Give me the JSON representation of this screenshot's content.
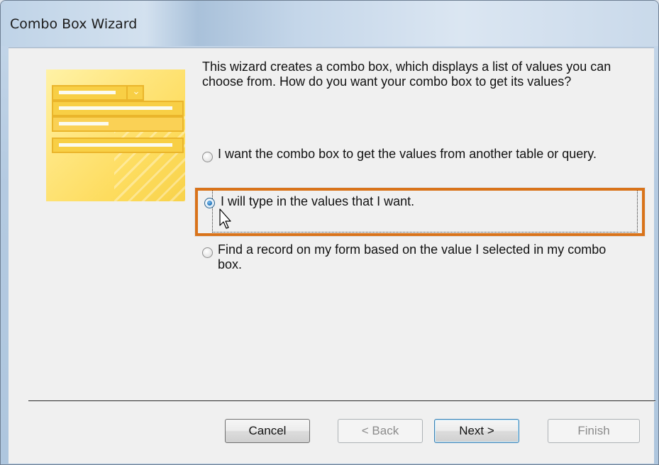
{
  "window": {
    "title": "Combo Box Wizard"
  },
  "intro": {
    "text": "This wizard creates a combo box, which displays a list of values you can choose from.  How do you want your combo box to get its values?"
  },
  "options": [
    {
      "label": "I want the combo box to get the values from another table or query.",
      "checked": false
    },
    {
      "label": "I will type in the values that I want.",
      "checked": true
    },
    {
      "label": "Find a record on my form based on the value I selected in my combo box.",
      "checked": false
    }
  ],
  "buttons": {
    "cancel": "Cancel",
    "back": "< Back",
    "next": "Next >",
    "finish": "Finish"
  },
  "colors": {
    "highlight": "#d9731a",
    "wizard_art": "#fddc5e"
  }
}
